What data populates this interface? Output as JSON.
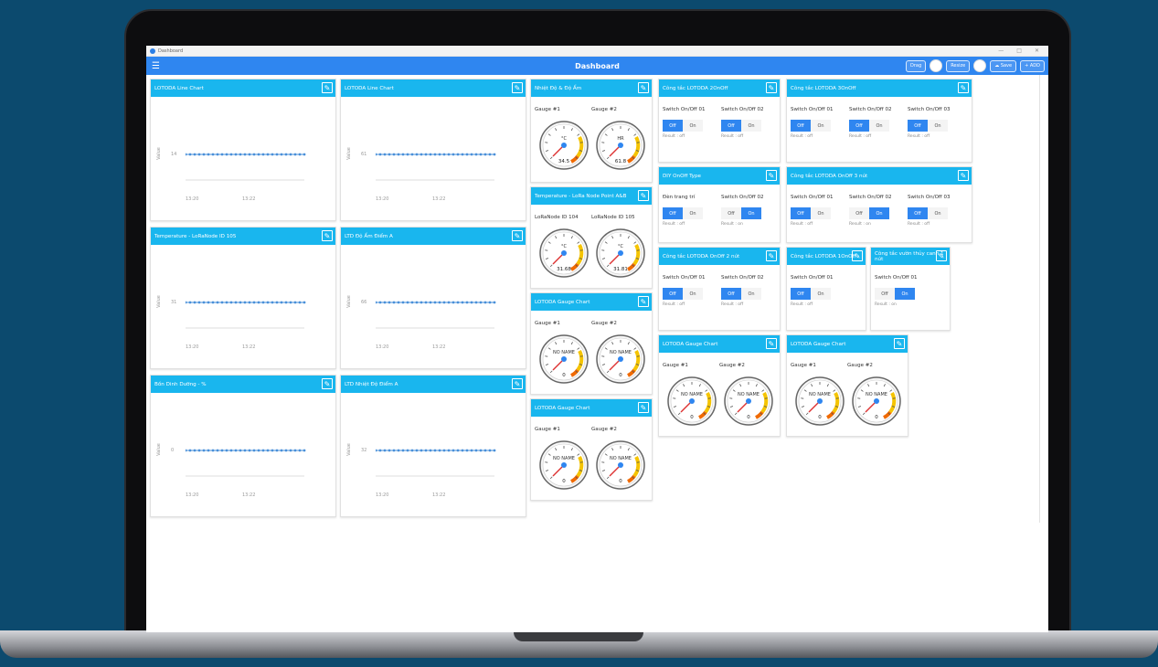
{
  "window": {
    "title": "Dashboard",
    "controls": [
      "—",
      "□",
      "✕"
    ]
  },
  "appbar": {
    "title": "Dashboard",
    "drag_label": "Drag",
    "resize_label": "Resize",
    "save_label": "Save",
    "add_label": "ADD",
    "menu_icon": "hamburger-icon"
  },
  "line_charts": [
    {
      "title": "LOTODA Line Chart",
      "ylabel": "Value",
      "value": "14",
      "ticks": [
        "13:20",
        "13:22"
      ]
    },
    {
      "title": "LOTODA Line Chart",
      "ylabel": "Value",
      "value": "61",
      "ticks": [
        "13:20",
        "13:22"
      ]
    },
    {
      "title": "Temperature - LoRaNode ID 105",
      "ylabel": "Value",
      "value": "31",
      "ticks": [
        "13:20",
        "13:22"
      ]
    },
    {
      "title": "LTD Độ Ẩm Điểm A",
      "ylabel": "Value",
      "value": "66",
      "ticks": [
        "13:20",
        "13:22"
      ]
    },
    {
      "title": "Bồn Dinh Dưỡng - %",
      "ylabel": "Value",
      "value": "0",
      "ticks": [
        "13:20",
        "13:22"
      ]
    },
    {
      "title": "LTD Nhiệt Độ Điểm A",
      "ylabel": "Value",
      "value": "32",
      "ticks": [
        "13:20",
        "13:22"
      ]
    }
  ],
  "gauge_cards": [
    {
      "title": "Nhiệt Độ & Độ Ẩm",
      "gauges": [
        {
          "label": "Gauge #1",
          "unit": "°C",
          "value": "34.5"
        },
        {
          "label": "Gauge #2",
          "unit": "HR",
          "value": "61.8"
        }
      ]
    },
    {
      "title": "Temperature - LoRa Node Point A&B",
      "gauges": [
        {
          "label": "LoRaNode ID 104",
          "unit": "°C",
          "value": "31.68"
        },
        {
          "label": "LoRaNode ID 105",
          "unit": "°C",
          "value": "31.81"
        }
      ]
    },
    {
      "title": "LOTODA Gauge Chart",
      "gauges": [
        {
          "label": "Gauge #1",
          "unit": "NO NAME",
          "value": "0"
        },
        {
          "label": "Gauge #2",
          "unit": "NO NAME",
          "value": "0"
        }
      ]
    },
    {
      "title": "LOTODA Gauge Chart",
      "gauges": [
        {
          "label": "Gauge #1",
          "unit": "NO NAME",
          "value": "0"
        },
        {
          "label": "Gauge #2",
          "unit": "NO NAME",
          "value": "0"
        }
      ]
    },
    {
      "title": "LOTODA Gauge Chart",
      "gauges": [
        {
          "label": "Gauge #1",
          "unit": "NO NAME",
          "value": "0"
        },
        {
          "label": "Gauge #2",
          "unit": "NO NAME",
          "value": "0"
        }
      ]
    },
    {
      "title": "LOTODA Gauge Chart",
      "gauges": [
        {
          "label": "Gauge #1",
          "unit": "NO NAME",
          "value": "0"
        },
        {
          "label": "Gauge #2",
          "unit": "NO NAME",
          "value": "0"
        }
      ]
    }
  ],
  "switch_cards": [
    {
      "title": "Công tắc LOTODA 2OnOff",
      "switches": [
        {
          "label": "Switch On/Off 01",
          "off": "Off",
          "on": "On",
          "state": "off",
          "result": "Result : off"
        },
        {
          "label": "Switch On/Off 02",
          "off": "Off",
          "on": "On",
          "state": "off",
          "result": "Result : off"
        }
      ]
    },
    {
      "title": "Công tắc LOTODA 3OnOff",
      "switches": [
        {
          "label": "Switch On/Off 01",
          "off": "Off",
          "on": "On",
          "state": "off",
          "result": "Result : off"
        },
        {
          "label": "Switch On/Off 02",
          "off": "Off",
          "on": "On",
          "state": "off",
          "result": "Result : off"
        },
        {
          "label": "Switch On/Off 03",
          "off": "Off",
          "on": "On",
          "state": "off",
          "result": "Result : off"
        }
      ]
    },
    {
      "title": "DIY OnOff Type",
      "switches": [
        {
          "label": "Đèn trang trí",
          "off": "Off",
          "on": "On",
          "state": "off",
          "result": "Result : off"
        },
        {
          "label": "Switch On/Off 02",
          "off": "Off",
          "on": "On",
          "state": "on",
          "result": "Result : on"
        }
      ]
    },
    {
      "title": "Công tắc LOTODA OnOff 3 nút",
      "switches": [
        {
          "label": "Switch On/Off 01",
          "off": "Off",
          "on": "On",
          "state": "off",
          "result": "Result : off"
        },
        {
          "label": "Switch On/Off 02",
          "off": "Off",
          "on": "On",
          "state": "on",
          "result": "Result : on"
        },
        {
          "label": "Switch On/Off 03",
          "off": "Off",
          "on": "On",
          "state": "off",
          "result": "Result : off"
        }
      ]
    },
    {
      "title": "Công tắc LOTODA OnOff 2 nút",
      "switches": [
        {
          "label": "Switch On/Off 01",
          "off": "Off",
          "on": "On",
          "state": "off",
          "result": "Result : off"
        },
        {
          "label": "Switch On/Off 02",
          "off": "Off",
          "on": "On",
          "state": "off",
          "result": "Result : off"
        }
      ]
    },
    {
      "title": "Công tắc LOTODA 1OnOff",
      "switches": [
        {
          "label": "Switch On/Off 01",
          "off": "Off",
          "on": "On",
          "state": "off",
          "result": "Result : off"
        }
      ]
    },
    {
      "title": "Công tắc vườn thủy canh 1 nút",
      "switches": [
        {
          "label": "Switch On/Off 01",
          "off": "Off",
          "on": "On",
          "state": "on",
          "result": "Result : on"
        }
      ]
    }
  ],
  "colors": {
    "accent": "#2f86f0",
    "card_header": "#19b6ee",
    "series": "#4a90d9"
  }
}
